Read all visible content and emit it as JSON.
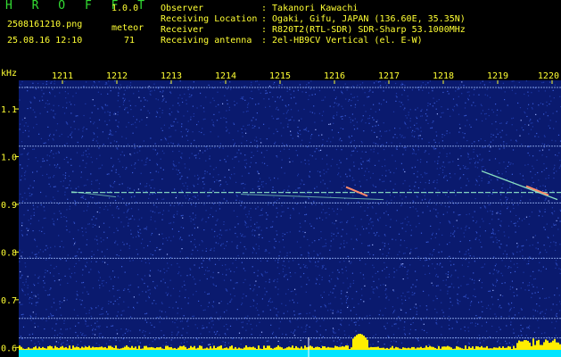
{
  "app": {
    "name": "H R O F F T",
    "version": "1.0.0"
  },
  "file": {
    "name": "2508161210.png",
    "datetime": "25.08.16 12:10"
  },
  "meteor": {
    "label": "meteor",
    "count": "71"
  },
  "info": [
    {
      "key": "Observer",
      "value": ": Takanori Kawachi"
    },
    {
      "key": "Receiving Location",
      "value": ": Ogaki, Gifu, JAPAN (136.60E, 35.35N)"
    },
    {
      "key": "Receiver",
      "value": ": R820T2(RTL-SDR) SDR-Sharp 53.1000MHz"
    },
    {
      "key": "Receiving antenna",
      "value": ": 2el-HB9CV Vertical (el. E-W)"
    }
  ],
  "chart_data": {
    "type": "heatmap",
    "ylabel": "kHz",
    "x_ticks": [
      "1211",
      "1212",
      "1213",
      "1214",
      "1215",
      "1216",
      "1217",
      "1218",
      "1219",
      "1220"
    ],
    "y_ticks": [
      "1.1",
      "1.0",
      "0.9",
      "0.8",
      "0.7",
      "0.6"
    ],
    "ylim": [
      0.58,
      1.16
    ],
    "horizontal_lines_khz": [
      1.145,
      1.022,
      0.903,
      0.787,
      0.661,
      0.62
    ],
    "carrier_khz": 0.925,
    "colors": {
      "background": "#0a1a6e",
      "noise": "#3a5cd8",
      "trace": "#9fffd0",
      "strong": "#ff8a6a",
      "bottom_band": "#00e5ff",
      "bottom_peak": "#ffee00"
    }
  }
}
